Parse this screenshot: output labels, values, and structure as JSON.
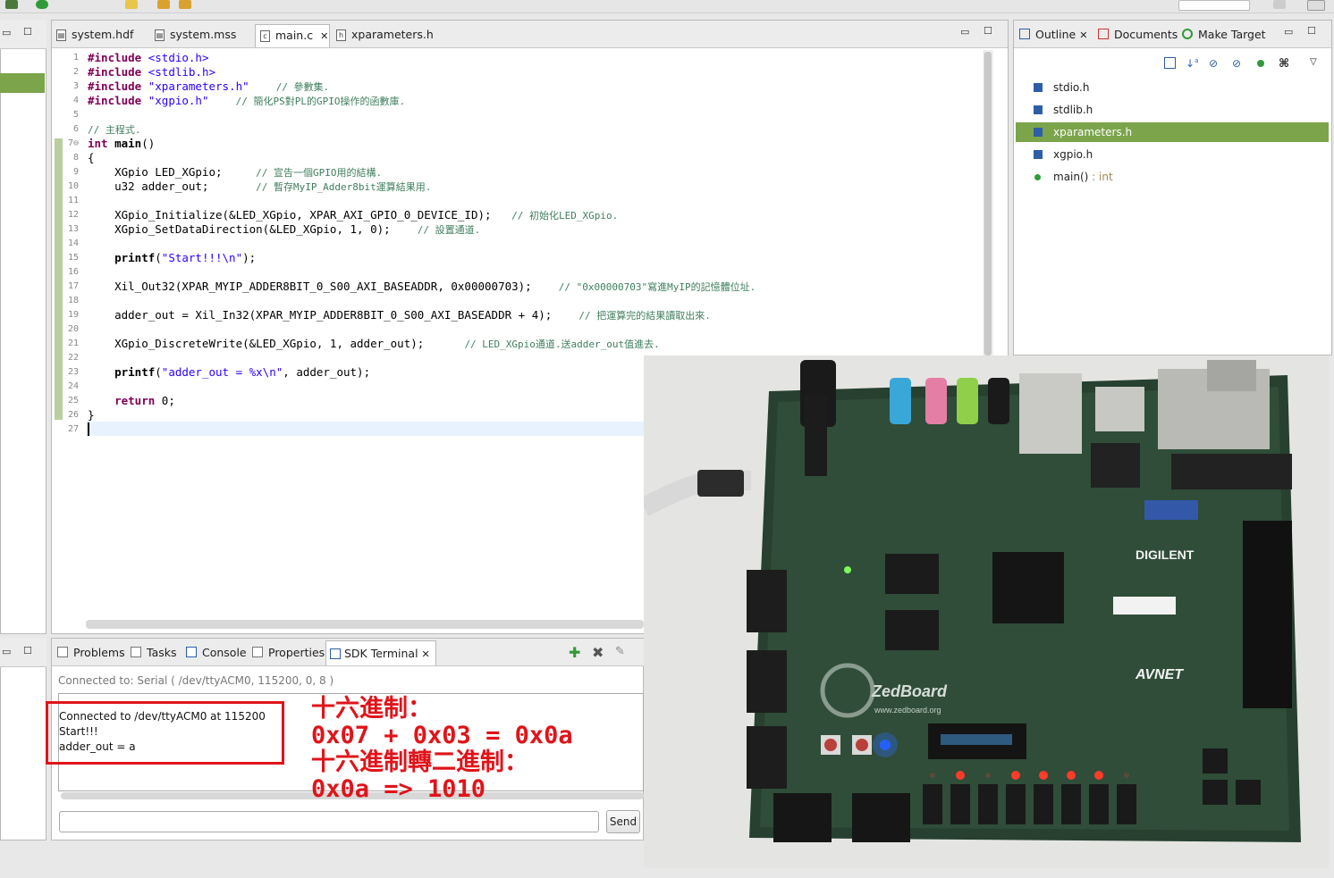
{
  "editor": {
    "tabs": [
      {
        "label": "system.hdf",
        "icon": "hdf-file-icon"
      },
      {
        "label": "system.mss",
        "icon": "mss-file-icon"
      },
      {
        "label": "main.c",
        "icon": "c-file-icon",
        "active": true
      },
      {
        "label": "xparameters.h",
        "icon": "h-file-icon"
      }
    ],
    "lines": [
      {
        "n": "1",
        "html": "<span class='kw'>#include</span> <span class='str'>&lt;stdio.h&gt;</span>"
      },
      {
        "n": "2",
        "html": "<span class='kw'>#include</span> <span class='str'>&lt;stdlib.h&gt;</span>"
      },
      {
        "n": "3",
        "html": "<span class='kw'>#include</span> <span class='str'>\"xparameters.h\"</span>    <span class='cm'>// 參數集.</span>"
      },
      {
        "n": "4",
        "html": "<span class='kw'>#include</span> <span class='str'>\"xgpio.h\"</span>    <span class='cm'>// 簡化PS對PL的GPIO操作的函數庫.</span>"
      },
      {
        "n": "5",
        "html": ""
      },
      {
        "n": "6",
        "html": "<span class='cm'>// 主程式.</span>"
      },
      {
        "n": "7⊖",
        "html": "<span class='kw'>int</span> <span class='fn'>main</span>()"
      },
      {
        "n": "8",
        "html": "{"
      },
      {
        "n": "9",
        "html": "    XGpio LED_XGpio;     <span class='cm'>// 宣告一個GPIO用的結構.</span>"
      },
      {
        "n": "10",
        "html": "    u32 adder_out;       <span class='cm'>// 暫存MyIP_Adder8bit運算結果用.</span>"
      },
      {
        "n": "11",
        "html": ""
      },
      {
        "n": "12",
        "html": "    XGpio_Initialize(&amp;LED_XGpio, XPAR_AXI_GPIO_0_DEVICE_ID);   <span class='cm'>// 初始化LED_XGpio.</span>"
      },
      {
        "n": "13",
        "html": "    XGpio_SetDataDirection(&amp;LED_XGpio, 1, 0);    <span class='cm'>// 設置通道.</span>"
      },
      {
        "n": "14",
        "html": ""
      },
      {
        "n": "15",
        "html": "    <span class='fn'>printf</span>(<span class='str'>\"Start!!!\\n\"</span>);"
      },
      {
        "n": "16",
        "html": ""
      },
      {
        "n": "17",
        "html": "    Xil_Out32(XPAR_MYIP_ADDER8BIT_0_S00_AXI_BASEADDR, 0x00000703);    <span class='cm'>// \"0x00000703\"寫進MyIP的記憶體位址.</span>"
      },
      {
        "n": "18",
        "html": ""
      },
      {
        "n": "19",
        "html": "    adder_out = Xil_In32(XPAR_MYIP_ADDER8BIT_0_S00_AXI_BASEADDR + 4);    <span class='cm'>// 把運算完的結果讀取出來.</span>"
      },
      {
        "n": "20",
        "html": ""
      },
      {
        "n": "21",
        "html": "    XGpio_DiscreteWrite(&amp;LED_XGpio, 1, adder_out);      <span class='cm'>// LED_XGpio通道.送adder_out值進去.</span>"
      },
      {
        "n": "22",
        "html": ""
      },
      {
        "n": "23",
        "html": "    <span class='fn'>printf</span>(<span class='str'>\"adder_out = %x\\n\"</span>, adder_out);"
      },
      {
        "n": "24",
        "html": ""
      },
      {
        "n": "25",
        "html": "    <span class='kw'>return</span> 0;"
      },
      {
        "n": "26",
        "html": "}"
      },
      {
        "n": "27",
        "html": ""
      }
    ]
  },
  "outline": {
    "tabs": [
      "Outline",
      "Documents",
      "Make Target"
    ],
    "items": [
      {
        "label": "stdio.h",
        "type": ""
      },
      {
        "label": "stdlib.h",
        "type": ""
      },
      {
        "label": "xparameters.h",
        "type": "",
        "selected": true
      },
      {
        "label": "xgpio.h",
        "type": ""
      },
      {
        "label": "main()",
        "type": " : int"
      }
    ]
  },
  "console": {
    "tabs": [
      "Problems",
      "Tasks",
      "Console",
      "Properties",
      "SDK Terminal"
    ],
    "connected_label": "Connected to: Serial ( /dev/ttyACM0, 115200, 0, 8 )",
    "terminal_lines": [
      "Connected to /dev/ttyACM0 at 115200",
      "Start!!!",
      "adder_out = a"
    ],
    "send_label": "Send"
  },
  "annotation": {
    "line1": "十六進制：",
    "line2": "0x07 + 0x03 = 0x0a",
    "line3": "十六進制轉二進制：",
    "line4": "0x0a => 1010"
  },
  "photo": {
    "board_brand": "ZedBoard",
    "board_url": "www.zedboard.org",
    "logo_digilent": "DIGILENT",
    "logo_avnet": "AVNET",
    "leds_on": [
      false,
      true,
      false,
      true,
      true,
      true,
      true,
      false
    ],
    "accent": "#2d4d3a"
  }
}
